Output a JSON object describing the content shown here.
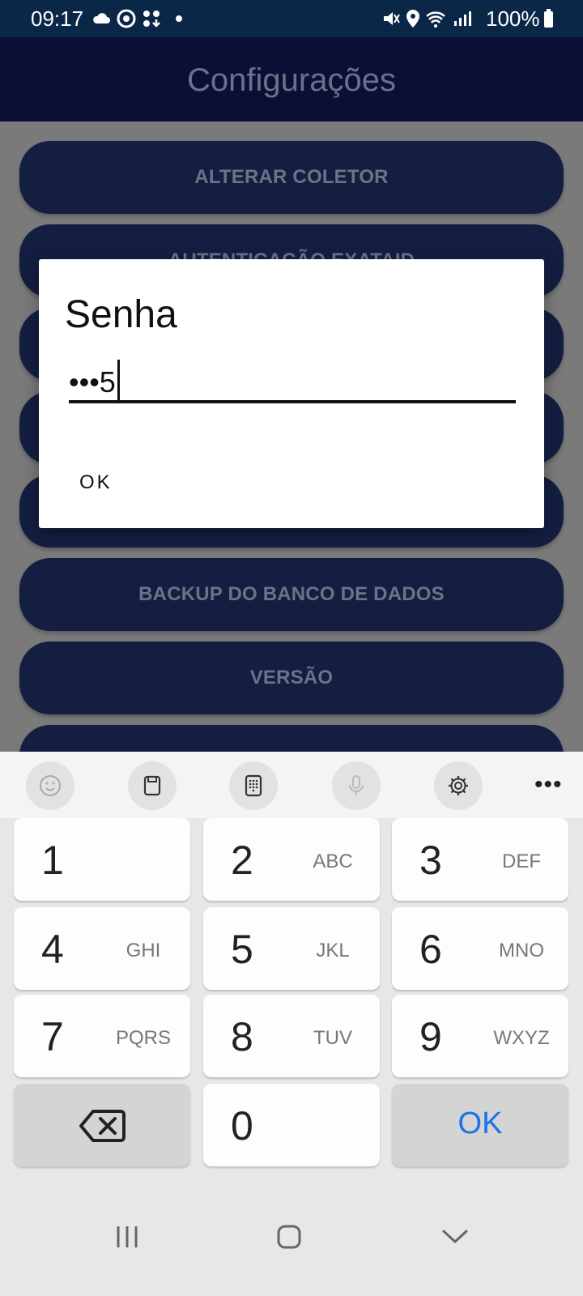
{
  "status_bar": {
    "time": "09:17",
    "battery": "100%"
  },
  "app_bar": {
    "title": "Configurações"
  },
  "settings": {
    "items": [
      {
        "label": "ALTERAR COLETOR"
      },
      {
        "label": "AUTENTICAÇÃO EXATAID"
      },
      {
        "label": ""
      },
      {
        "label": ""
      },
      {
        "label": ""
      },
      {
        "label": "BACKUP DO BANCO DE DADOS"
      },
      {
        "label": "VERSÃO"
      },
      {
        "label": ""
      }
    ]
  },
  "dialog": {
    "title": "Senha",
    "password_display": "•••5",
    "ok_label": "OK"
  },
  "keyboard": {
    "toolbar": [
      "emoji-icon",
      "clipboard-icon",
      "keypad-icon",
      "microphone-icon",
      "settings-gear-icon",
      "more-icon"
    ],
    "more_label": "•••",
    "keys": [
      {
        "num": "1",
        "letters": ""
      },
      {
        "num": "2",
        "letters": "ABC"
      },
      {
        "num": "3",
        "letters": "DEF"
      },
      {
        "num": "4",
        "letters": "GHI"
      },
      {
        "num": "5",
        "letters": "JKL"
      },
      {
        "num": "6",
        "letters": "MNO"
      },
      {
        "num": "7",
        "letters": "PQRS"
      },
      {
        "num": "8",
        "letters": "TUV"
      },
      {
        "num": "9",
        "letters": "WXYZ"
      },
      {
        "num": "0",
        "letters": ""
      }
    ],
    "ok_label": "OK"
  },
  "colors": {
    "status_bar": "#0b2748",
    "app_bar": "#0b0f35",
    "setting_button": "#131e41",
    "overlay": "#7a7a7a",
    "ok_key_text": "#1a73e8"
  }
}
